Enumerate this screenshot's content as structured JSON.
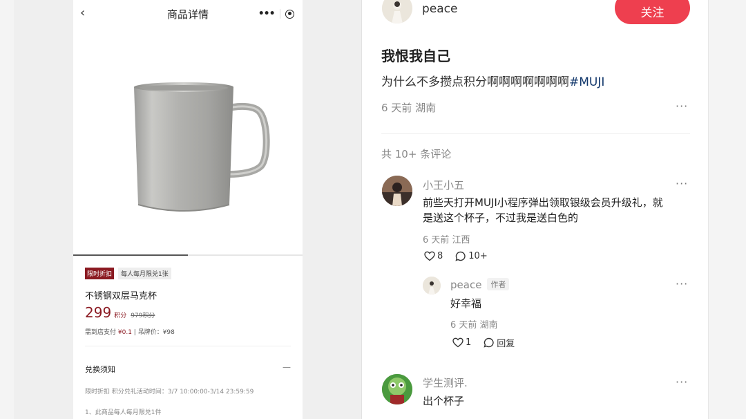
{
  "mini_program": {
    "nav": {
      "back_glyph": "‹",
      "title": "商品详情",
      "more_glyph": "•••"
    },
    "image": {
      "subject": "stainless steel mug"
    },
    "progress_fraction": 0.5,
    "tags": [
      "限时折扣",
      "每人每月限兑1张"
    ],
    "product_name": "不锈钢双层马克杯",
    "price": {
      "points": "299",
      "unit": "积分",
      "original": "979积分"
    },
    "pay": {
      "prefix": "需到店支付",
      "amount": "¥0.1",
      "suffix": " | 吊牌价：¥98"
    },
    "notice": {
      "title": "兑换须知",
      "toggle": "—",
      "time_text": "限时折扣 积分兑礼活动时间：3/7 10:00:00-3/14 23:59:59",
      "rule_1": "1、此商品每人每月限兑1件"
    }
  },
  "post": {
    "author": "peace",
    "follow_label": "关注",
    "title": "我恨我自己",
    "body": "为什么不多攒点积分啊啊啊啊啊啊啊",
    "hashtag": "#MUJI",
    "meta": "6 天前 湖南",
    "more": "···",
    "comment_count": "共 10+ 条评论"
  },
  "comments": [
    {
      "name": "小王小五",
      "text_line1": "前些天打开MUJI小程序弹出领取银级会员升级礼，就",
      "text_line2": "是送这个杯子，不过我是送白色的",
      "meta": "6 天前 江西",
      "likes": "8",
      "replies": "10+"
    },
    {
      "name": "peace",
      "tag": "作者",
      "text": "好幸福",
      "meta": "6 天前 湖南",
      "likes": "1",
      "reply_label": "回复"
    },
    {
      "name": "学生测评.",
      "text": "出个杯子"
    }
  ],
  "colors": {
    "accent_red": "#ee3f4f",
    "price_red": "#8b1a22",
    "hashtag_blue": "#13386c"
  },
  "icons": [
    "back-icon",
    "more-icon",
    "target-icon",
    "heart-icon",
    "comment-icon"
  ]
}
